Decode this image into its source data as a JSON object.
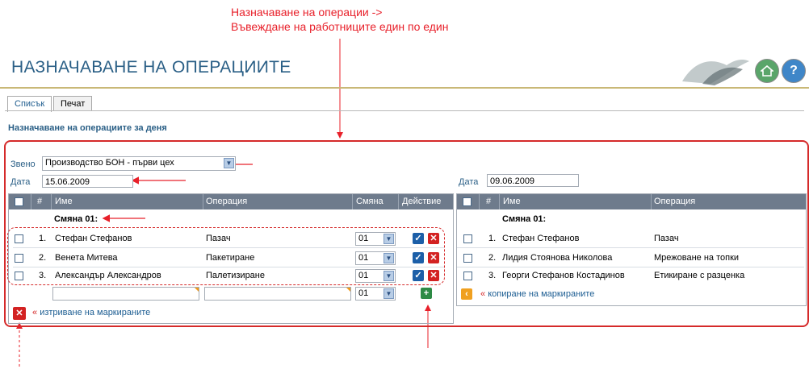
{
  "annotation": {
    "line1": "Назначаване на операции ->",
    "line2": "Въвеждане на работниците един по един"
  },
  "header": {
    "title": "НАЗНАЧАВАНЕ НА ОПЕРАЦИИТЕ",
    "help_symbol": "?"
  },
  "tabs": [
    {
      "label": "Списък",
      "active": true
    },
    {
      "label": "Печат",
      "active": false
    }
  ],
  "subtitle": "Назначаване на операциите за деня",
  "filters": {
    "unit_label": "Звено",
    "unit_value": "Производство БОН - първи цех",
    "date_label": "Дата",
    "date_value": "15.06.2009"
  },
  "left_table": {
    "columns": [
      "#",
      "Име",
      "Операция",
      "Смяна",
      "Действие"
    ],
    "shift_group": "Смяна 01:",
    "rows": [
      {
        "num": "1.",
        "name": "Стефан Стефанов",
        "operation": "Пазач",
        "shift": "01"
      },
      {
        "num": "2.",
        "name": "Венета Митева",
        "operation": "Пакетиране",
        "shift": "01"
      },
      {
        "num": "3.",
        "name": "Александър Александров",
        "operation": "Палетизиране",
        "shift": "01"
      }
    ],
    "new_row_shift": "01",
    "delete_marked_link": "изтриване на маркираните"
  },
  "right_table": {
    "date_label": "Дата",
    "date_value": "09.06.2009",
    "columns": [
      "#",
      "Име",
      "Операция"
    ],
    "shift_group": "Смяна 01:",
    "rows": [
      {
        "num": "1.",
        "name": "Стефан Стефанов",
        "operation": "Пазач"
      },
      {
        "num": "2.",
        "name": "Лидия Стоянова Николова",
        "operation": "Мрежоване на топки"
      },
      {
        "num": "3.",
        "name": "Георги Стефанов Костадинов",
        "operation": "Етикиране с разценка"
      }
    ],
    "copy_marked_link": "копиране на маркираните"
  },
  "colors": {
    "accent": "#2a5f86",
    "annotation_red": "#e8202a",
    "grid_header": "#6e7b8c"
  }
}
